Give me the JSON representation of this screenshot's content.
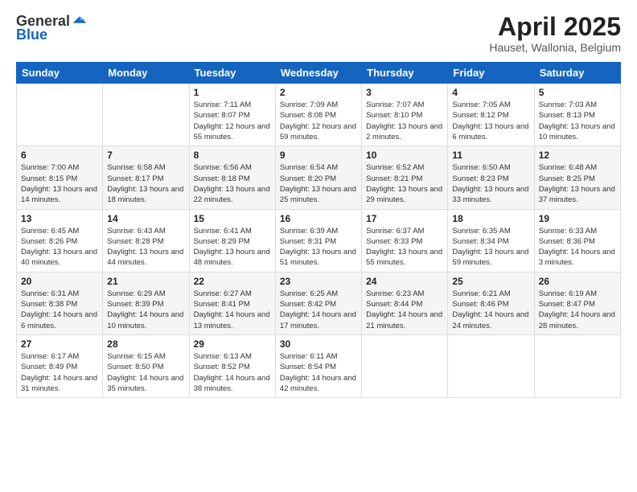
{
  "logo": {
    "general": "General",
    "blue": "Blue"
  },
  "title": "April 2025",
  "subtitle": "Hauset, Wallonia, Belgium",
  "days_header": [
    "Sunday",
    "Monday",
    "Tuesday",
    "Wednesday",
    "Thursday",
    "Friday",
    "Saturday"
  ],
  "weeks": [
    [
      {
        "day": "",
        "sunrise": "",
        "sunset": "",
        "daylight": ""
      },
      {
        "day": "",
        "sunrise": "",
        "sunset": "",
        "daylight": ""
      },
      {
        "day": "1",
        "sunrise": "Sunrise: 7:11 AM",
        "sunset": "Sunset: 8:07 PM",
        "daylight": "Daylight: 12 hours and 55 minutes."
      },
      {
        "day": "2",
        "sunrise": "Sunrise: 7:09 AM",
        "sunset": "Sunset: 8:08 PM",
        "daylight": "Daylight: 12 hours and 59 minutes."
      },
      {
        "day": "3",
        "sunrise": "Sunrise: 7:07 AM",
        "sunset": "Sunset: 8:10 PM",
        "daylight": "Daylight: 13 hours and 2 minutes."
      },
      {
        "day": "4",
        "sunrise": "Sunrise: 7:05 AM",
        "sunset": "Sunset: 8:12 PM",
        "daylight": "Daylight: 13 hours and 6 minutes."
      },
      {
        "day": "5",
        "sunrise": "Sunrise: 7:03 AM",
        "sunset": "Sunset: 8:13 PM",
        "daylight": "Daylight: 13 hours and 10 minutes."
      }
    ],
    [
      {
        "day": "6",
        "sunrise": "Sunrise: 7:00 AM",
        "sunset": "Sunset: 8:15 PM",
        "daylight": "Daylight: 13 hours and 14 minutes."
      },
      {
        "day": "7",
        "sunrise": "Sunrise: 6:58 AM",
        "sunset": "Sunset: 8:17 PM",
        "daylight": "Daylight: 13 hours and 18 minutes."
      },
      {
        "day": "8",
        "sunrise": "Sunrise: 6:56 AM",
        "sunset": "Sunset: 8:18 PM",
        "daylight": "Daylight: 13 hours and 22 minutes."
      },
      {
        "day": "9",
        "sunrise": "Sunrise: 6:54 AM",
        "sunset": "Sunset: 8:20 PM",
        "daylight": "Daylight: 13 hours and 25 minutes."
      },
      {
        "day": "10",
        "sunrise": "Sunrise: 6:52 AM",
        "sunset": "Sunset: 8:21 PM",
        "daylight": "Daylight: 13 hours and 29 minutes."
      },
      {
        "day": "11",
        "sunrise": "Sunrise: 6:50 AM",
        "sunset": "Sunset: 8:23 PM",
        "daylight": "Daylight: 13 hours and 33 minutes."
      },
      {
        "day": "12",
        "sunrise": "Sunrise: 6:48 AM",
        "sunset": "Sunset: 8:25 PM",
        "daylight": "Daylight: 13 hours and 37 minutes."
      }
    ],
    [
      {
        "day": "13",
        "sunrise": "Sunrise: 6:45 AM",
        "sunset": "Sunset: 8:26 PM",
        "daylight": "Daylight: 13 hours and 40 minutes."
      },
      {
        "day": "14",
        "sunrise": "Sunrise: 6:43 AM",
        "sunset": "Sunset: 8:28 PM",
        "daylight": "Daylight: 13 hours and 44 minutes."
      },
      {
        "day": "15",
        "sunrise": "Sunrise: 6:41 AM",
        "sunset": "Sunset: 8:29 PM",
        "daylight": "Daylight: 13 hours and 48 minutes."
      },
      {
        "day": "16",
        "sunrise": "Sunrise: 6:39 AM",
        "sunset": "Sunset: 8:31 PM",
        "daylight": "Daylight: 13 hours and 51 minutes."
      },
      {
        "day": "17",
        "sunrise": "Sunrise: 6:37 AM",
        "sunset": "Sunset: 8:33 PM",
        "daylight": "Daylight: 13 hours and 55 minutes."
      },
      {
        "day": "18",
        "sunrise": "Sunrise: 6:35 AM",
        "sunset": "Sunset: 8:34 PM",
        "daylight": "Daylight: 13 hours and 59 minutes."
      },
      {
        "day": "19",
        "sunrise": "Sunrise: 6:33 AM",
        "sunset": "Sunset: 8:36 PM",
        "daylight": "Daylight: 14 hours and 3 minutes."
      }
    ],
    [
      {
        "day": "20",
        "sunrise": "Sunrise: 6:31 AM",
        "sunset": "Sunset: 8:38 PM",
        "daylight": "Daylight: 14 hours and 6 minutes."
      },
      {
        "day": "21",
        "sunrise": "Sunrise: 6:29 AM",
        "sunset": "Sunset: 8:39 PM",
        "daylight": "Daylight: 14 hours and 10 minutes."
      },
      {
        "day": "22",
        "sunrise": "Sunrise: 6:27 AM",
        "sunset": "Sunset: 8:41 PM",
        "daylight": "Daylight: 14 hours and 13 minutes."
      },
      {
        "day": "23",
        "sunrise": "Sunrise: 6:25 AM",
        "sunset": "Sunset: 8:42 PM",
        "daylight": "Daylight: 14 hours and 17 minutes."
      },
      {
        "day": "24",
        "sunrise": "Sunrise: 6:23 AM",
        "sunset": "Sunset: 8:44 PM",
        "daylight": "Daylight: 14 hours and 21 minutes."
      },
      {
        "day": "25",
        "sunrise": "Sunrise: 6:21 AM",
        "sunset": "Sunset: 8:46 PM",
        "daylight": "Daylight: 14 hours and 24 minutes."
      },
      {
        "day": "26",
        "sunrise": "Sunrise: 6:19 AM",
        "sunset": "Sunset: 8:47 PM",
        "daylight": "Daylight: 14 hours and 28 minutes."
      }
    ],
    [
      {
        "day": "27",
        "sunrise": "Sunrise: 6:17 AM",
        "sunset": "Sunset: 8:49 PM",
        "daylight": "Daylight: 14 hours and 31 minutes."
      },
      {
        "day": "28",
        "sunrise": "Sunrise: 6:15 AM",
        "sunset": "Sunset: 8:50 PM",
        "daylight": "Daylight: 14 hours and 35 minutes."
      },
      {
        "day": "29",
        "sunrise": "Sunrise: 6:13 AM",
        "sunset": "Sunset: 8:52 PM",
        "daylight": "Daylight: 14 hours and 38 minutes."
      },
      {
        "day": "30",
        "sunrise": "Sunrise: 6:11 AM",
        "sunset": "Sunset: 8:54 PM",
        "daylight": "Daylight: 14 hours and 42 minutes."
      },
      {
        "day": "",
        "sunrise": "",
        "sunset": "",
        "daylight": ""
      },
      {
        "day": "",
        "sunrise": "",
        "sunset": "",
        "daylight": ""
      },
      {
        "day": "",
        "sunrise": "",
        "sunset": "",
        "daylight": ""
      }
    ]
  ]
}
